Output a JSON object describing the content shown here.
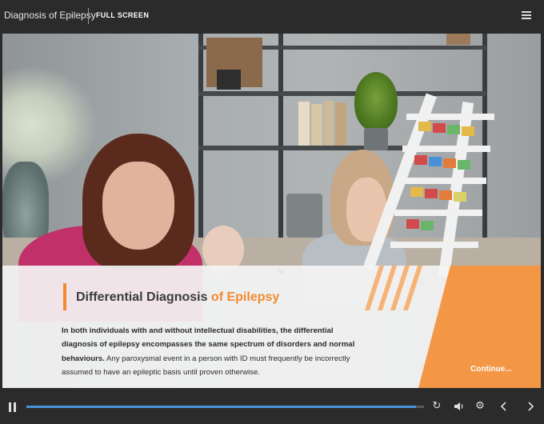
{
  "header": {
    "course_title": "Diagnosis of Epilepsy",
    "fullscreen_label": "FULL SCREEN",
    "menu_icon": "hamburger-menu-icon"
  },
  "slide": {
    "headline_main": "Differential Diagnosis ",
    "headline_accent": "of Epilepsy",
    "body_bold": "In both individuals with and without intellectual disabilities, the differential diagnosis of epilepsy encompasses the same spectrum of disorders and normal behaviours.",
    "body_regular": " Any paroxysmal event in a person with ID must frequently be incorrectly assumed to have an epileptic basis until proven otherwise.",
    "continue_label": "Continue...",
    "accent_color": "#f28a2f",
    "panel_color": "#f39645"
  },
  "controls": {
    "progress": 0.98,
    "icons": [
      "pause-icon",
      "replay-icon",
      "volume-icon",
      "settings-icon",
      "previous-icon",
      "next-icon"
    ],
    "progress_color": "#4a90d9"
  }
}
